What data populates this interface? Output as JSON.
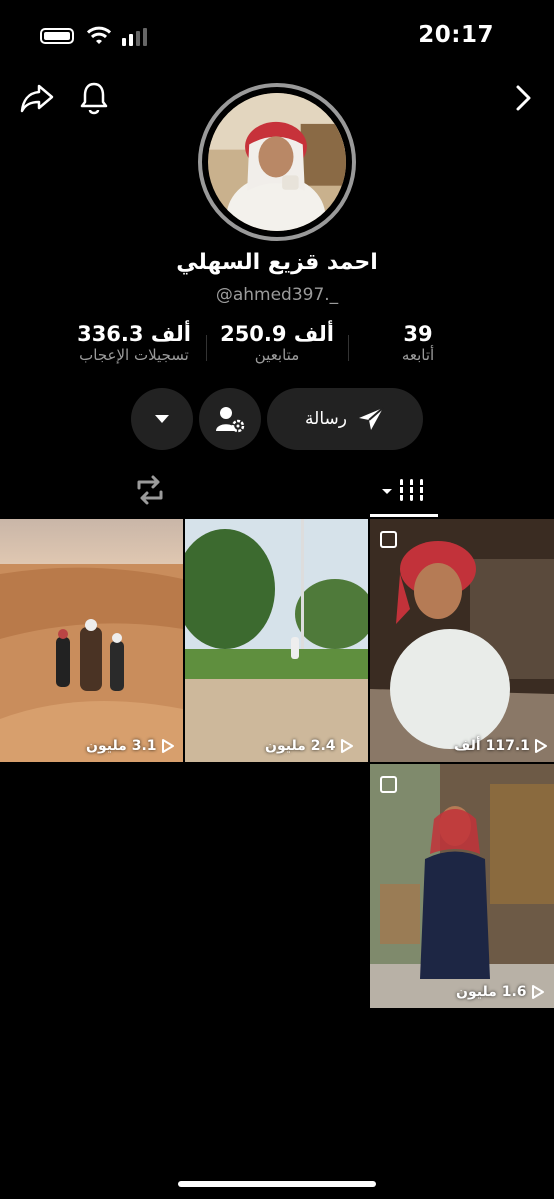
{
  "status": {
    "time": "20:17"
  },
  "profile": {
    "name": "احمد قزيع السهلي",
    "handle": "@ahmed397._"
  },
  "stats": [
    {
      "value": "336.3 ألف",
      "label": "تسجيلات الإعجاب"
    },
    {
      "value": "250.9 ألف",
      "label": "متابعين"
    },
    {
      "value": "39",
      "label": "أتابعه"
    }
  ],
  "actions": {
    "message_label": "رسالة"
  },
  "videos": [
    {
      "views": "3.1 مليون",
      "multi": false
    },
    {
      "views": "2.4 مليون",
      "multi": false
    },
    {
      "views": "117.1 ألف",
      "multi": true
    },
    {
      "views": "1.6 مليون",
      "multi": true
    }
  ]
}
